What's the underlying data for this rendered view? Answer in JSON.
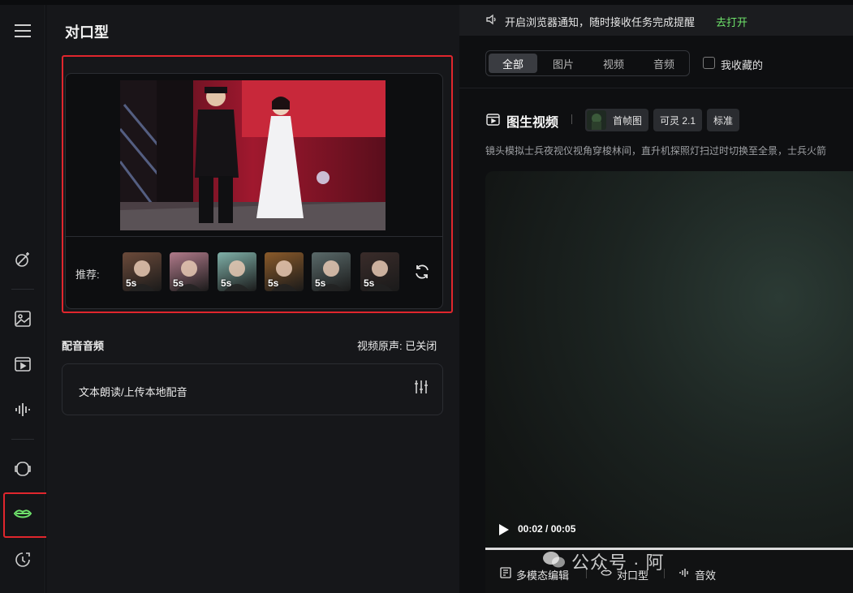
{
  "panel": {
    "title": "对口型",
    "recommend_label": "推荐:",
    "thumbnails": [
      {
        "duration": "5s",
        "bg": "#6b4a3a"
      },
      {
        "duration": "5s",
        "bg": "#b07a8a"
      },
      {
        "duration": "5s",
        "bg": "#7fb0a8"
      },
      {
        "duration": "5s",
        "bg": "#8a5a2a"
      },
      {
        "duration": "5s",
        "bg": "#5a6a6a"
      },
      {
        "duration": "5s",
        "bg": "#3a2c2a"
      }
    ],
    "audio_title": "配音音频",
    "audio_status": "视频原声: 已关闭",
    "audio_box_label": "文本朗读/上传本地配音"
  },
  "notice": {
    "text": "开启浏览器通知，随时接收任务完成提醒",
    "link": "去打开"
  },
  "filter_tabs": [
    {
      "label": "全部",
      "active": true
    },
    {
      "label": "图片",
      "active": false
    },
    {
      "label": "视频",
      "active": false
    },
    {
      "label": "音频",
      "active": false
    }
  ],
  "favorites_label": "我收藏的",
  "video": {
    "title": "图生视频",
    "chips": [
      "首帧图",
      "可灵 2.1",
      "标准"
    ],
    "description": "镜头模拟士兵夜视仪视角穿梭林间，直升机探照灯扫过时切换至全景，士兵火箭",
    "time": "00:02 / 00:05",
    "progress_fraction": 0.4
  },
  "tools": [
    "多模态编辑",
    "对口型",
    "音效"
  ],
  "watermark": "公众号 · 阿",
  "colors": {
    "accent_green": "#6fe36b",
    "highlight_red": "#e0262d"
  },
  "rail_icons": [
    "menu-icon",
    "magic-wand-icon",
    "image-icon",
    "video-icon",
    "audio-wave-icon",
    "face-icon",
    "lips-icon",
    "history-icon"
  ]
}
